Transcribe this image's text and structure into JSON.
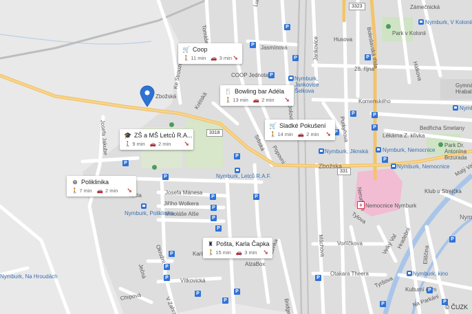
{
  "map": {
    "copyright": "© ČUZK",
    "road_shields": [
      "3323",
      "3318",
      "331"
    ],
    "colors": {
      "background": "#e9e9e9",
      "block": "#dcdcdc",
      "road": "#ffffff",
      "main_road": "#f3c46c",
      "river": "#a9c5e8",
      "park": "#cfe3c5",
      "hospital": "#f2bcd3",
      "marker": "#2f72d6",
      "arrow": "#c23b3b"
    }
  },
  "streets": {
    "zamecnicka": "Zámečnická",
    "tomase": "Tomáše",
    "ludvika": "Ludvíka",
    "husova": "Husova",
    "boleslavska_trida": "Boleslavská třída",
    "jasminova": "Jasmínová",
    "park_v_kolonii": "Park v Kolonii",
    "nymburk_v_kolonii": "Nymburk, V Kolonii",
    "hakova": "Hálkova",
    "ulice_28_rijna": "28. října",
    "coop_jednota": "COOP Jednota",
    "nymburk_jankovice": "Nymburk, Jankovice Šelkova",
    "jankovice": "Jankovice",
    "gymnazium": "Gymnázium Hrabala",
    "topolova": "Topolová",
    "ke_strouze": "Ke Strouze",
    "zbozska": "Zbožská",
    "kretska": "Krétská",
    "komenskeho": "Komenského",
    "purkynova": "Purkyňova",
    "bedricha_smetany": "Bedřicha Smetany",
    "nymburk_ka": "Nymbu",
    "park_antonina": "Park Dr. Antonína Brzurada",
    "lekarna": "Lékárna Z. křivka",
    "nymburk_nemocnice": "Nymburk, Nemocnice",
    "nymburk_jiknska": "Nymburk, Jiknská",
    "srbska": "Srbská",
    "popovni": "Popovní",
    "josefa_jakube": "Josefa Jakube",
    "zbozska_main": "Zbožská",
    "nymburk_letcu": "Nymburk, Letců R.A.F.",
    "nerudova": "Nerudova",
    "nemocnice_nymburk": "Nemocnice Nymburk",
    "klub_strejcka": "Klub u Strejčka",
    "josefa_manesa": "Josefa Mánesa",
    "jiriho_wolkera": "Jiřího Wolkera",
    "mikolase_alse": "Mikoláše Alše",
    "nymburk_poliklinika": "Nymburk, Poliklinika",
    "okruzni": "Okružní",
    "tylova": "Tylova",
    "machova": "Máchova",
    "vorlickova": "Vorlíčkova",
    "velky_val": "Velký Val",
    "hradebni": "Hradební",
    "eliscina": "Eliščina",
    "nym_right": "Nym",
    "jecna": "Ječná",
    "karla_capka": "Karla Čapka",
    "albabox": "AlzaBox",
    "ludvika_bottom": "Ludvíka",
    "vitkovicka": "Vítkovická",
    "nymburk_na_hroudach": "Nymburk, Na Hroudách",
    "chrpova": "Chrpová",
    "v_zahrad": "V Zahrad.",
    "otakara_theera": "Otakara Theera",
    "tyrsova": "Tyršova",
    "nymburk_kino": "Nymburk, kino",
    "kulturni_dum": "Kulturní dům",
    "na_parkani": "Na Parkáni",
    "bridgeova": "Bridgeova",
    "maly_val": "Malý Val",
    "poliklinika_short": "Nikla"
  },
  "pois": [
    {
      "name": "Coop",
      "icon": "cart-icon",
      "walk": "11 min",
      "car": "3 min"
    },
    {
      "name": "Bowling bar Adéla",
      "icon": "fork-knife-icon",
      "walk": "13 min",
      "car": "2 min"
    },
    {
      "name": "Sladké Pokušení",
      "icon": "cart-icon",
      "walk": "14 min",
      "car": "2 min"
    },
    {
      "name": "ZŠ a MŠ Letců R.A...",
      "icon": "school-icon",
      "walk": "9 min",
      "car": "2 min"
    },
    {
      "name": "Poliklinika",
      "icon": "medical-icon",
      "walk": "7 min",
      "car": "2 min"
    },
    {
      "name": "Pošta, Karla Čapka",
      "icon": "post-icon",
      "walk": "15 min",
      "car": "3 min"
    }
  ]
}
